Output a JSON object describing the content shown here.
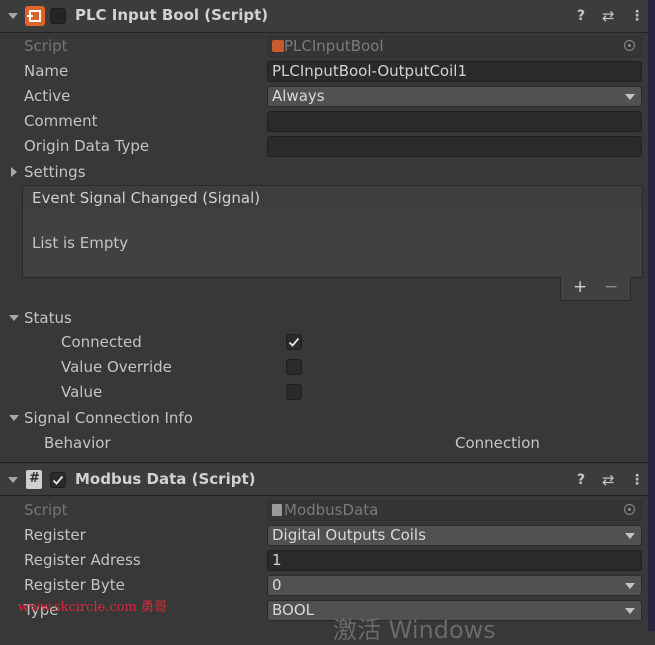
{
  "plc_component": {
    "title": "PLC Input Bool (Script)",
    "script_label": "Script",
    "script_value": "PLCInputBool",
    "name_label": "Name",
    "name_value": "PLCInputBool-OutputCoil1",
    "active_label": "Active",
    "active_value": "Always",
    "comment_label": "Comment",
    "comment_value": "",
    "origin_label": "Origin Data Type",
    "origin_value": "",
    "settings_label": "Settings",
    "event_title": "Event Signal Changed (Signal)",
    "event_empty": "List is Empty",
    "add_label": "+",
    "remove_label": "−",
    "status_label": "Status",
    "connected_label": "Connected",
    "connected_checked": true,
    "override_label": "Value Override",
    "override_checked": false,
    "value_label": "Value",
    "value_checked": false,
    "signal_info_label": "Signal Connection Info",
    "behavior_label": "Behavior",
    "connection_label": "Connection"
  },
  "modbus_component": {
    "title": "Modbus Data (Script)",
    "enabled": true,
    "script_label": "Script",
    "script_value": "ModbusData",
    "register_label": "Register",
    "register_value": "Digital Outputs Coils",
    "adress_label": "Register Adress",
    "adress_value": "1",
    "byte_label": "Register Byte",
    "byte_value": "0",
    "type_label": "Type",
    "type_value": "BOOL"
  },
  "overlays": {
    "watermark": "www.skcircle.com 勇哥",
    "activation": "激活 Windows"
  },
  "colors": {
    "panel": "#383838",
    "header": "#3c3c3c",
    "plc_icon": "#e2622c",
    "watermark": "#d8283a"
  }
}
